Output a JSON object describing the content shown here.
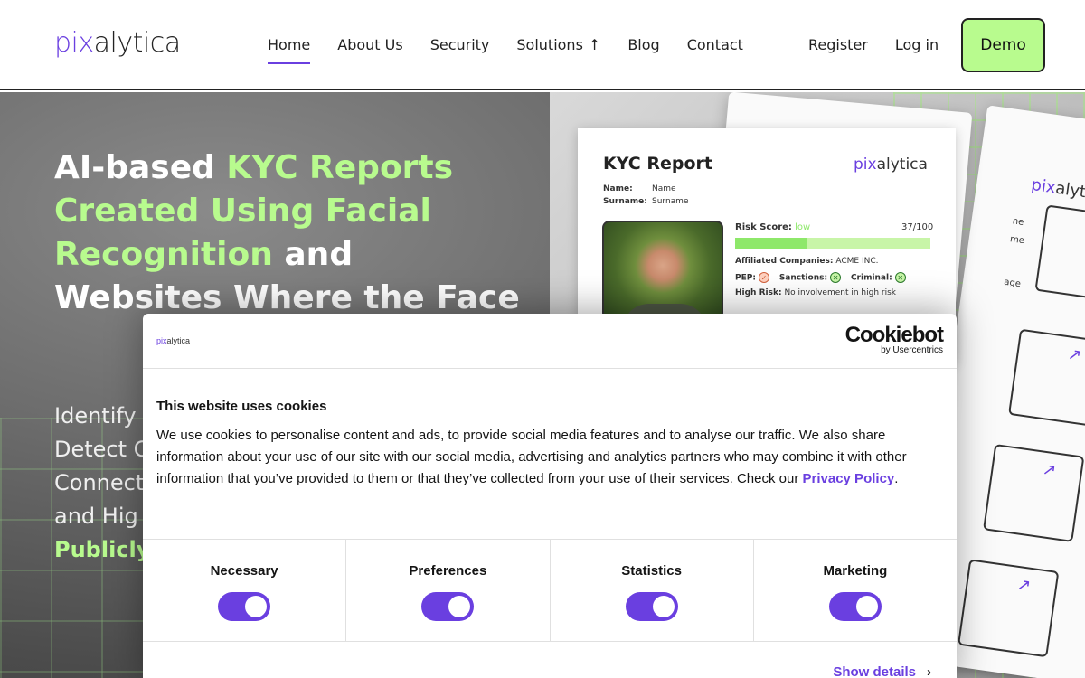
{
  "brand": {
    "logo_prefix": "pix",
    "logo_suffix": "alytica"
  },
  "nav": {
    "home": "Home",
    "about": "About Us",
    "security": "Security",
    "solutions": "Solutions",
    "solutions_arrow": "↑",
    "blog": "Blog",
    "contact": "Contact"
  },
  "auth": {
    "register": "Register",
    "login": "Log in",
    "demo": "Demo"
  },
  "hero": {
    "title_part1": "AI-based ",
    "title_highlight": "KYC Reports Created Using Facial Recognition",
    "title_part2": " and Websites Where the Face",
    "list": [
      "Identify",
      "Detect C",
      "Connect",
      "and Hig"
    ],
    "list_bold": "Publicly"
  },
  "kyc_card": {
    "title": "KYC Report",
    "name_label": "Name:",
    "name_value": "Name",
    "surname_label": "Surname:",
    "surname_value": "Surname",
    "risk_label": "Risk Score:",
    "risk_level": "low",
    "risk_score": "37/100",
    "risk_fraction": 0.37,
    "affiliated_label": "Affiliated Companies:",
    "affiliated_value": "ACME INC.",
    "pep_label": "PEP:",
    "sanctions_label": "Sanctions:",
    "criminal_label": "Criminal:",
    "high_risk_label": "High Risk:",
    "high_risk_value": "No involvement in high risk",
    "sheet_name": "ne",
    "sheet_me": "me",
    "sheet_age": "age"
  },
  "cookie": {
    "brand_name": "Cookiebot",
    "brand_by": "by Usercentrics",
    "title": "This website uses cookies",
    "text": "We use cookies to personalise content and ads, to provide social media features and to analyse our traffic. We also share information about your use of our site with our social media, advertising and analytics partners who may combine it with other information that you’ve provided to them or that they’ve collected from your use of their services. Check our ",
    "privacy_link": "Privacy Policy",
    "text_end": ".",
    "categories": [
      {
        "label": "Necessary",
        "enabled": true
      },
      {
        "label": "Preferences",
        "enabled": true
      },
      {
        "label": "Statistics",
        "enabled": true
      },
      {
        "label": "Marketing",
        "enabled": true
      }
    ],
    "show_details": "Show details",
    "show_details_chevron": "›"
  },
  "colors": {
    "accent": "#6a3fe0",
    "green": "#b8fb8e",
    "risk_fill": "#8ee86a"
  }
}
